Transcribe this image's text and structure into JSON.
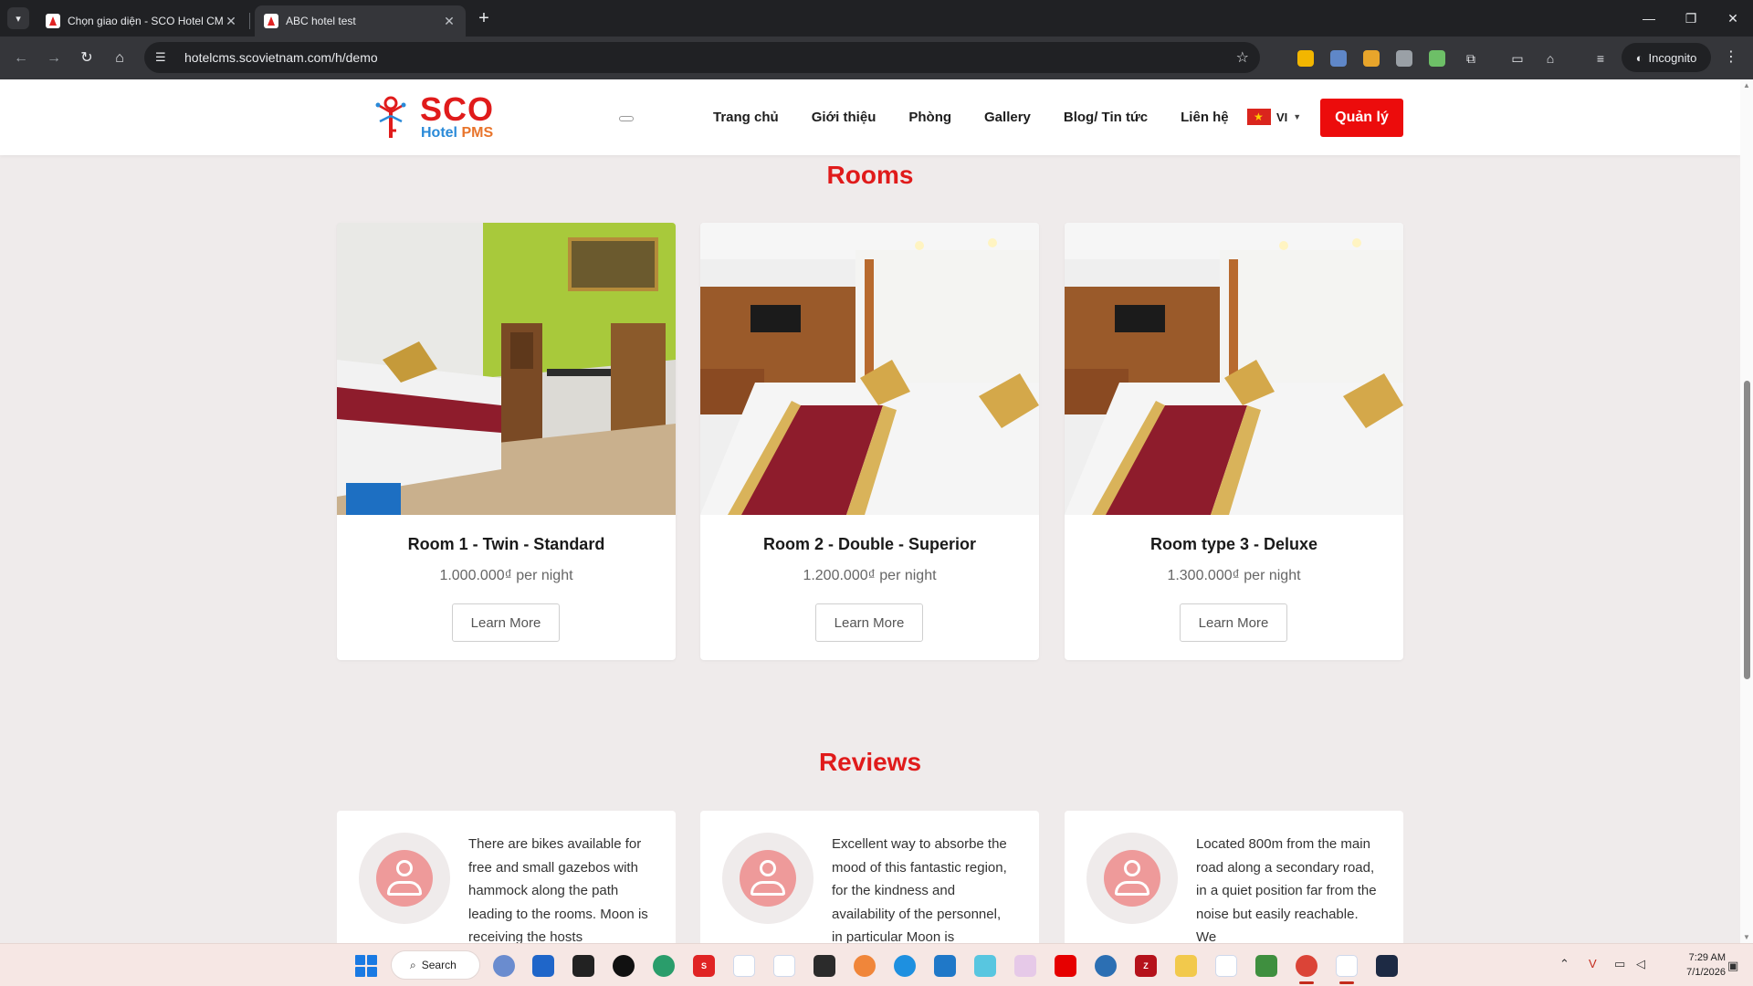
{
  "browser": {
    "tabs": [
      {
        "title": "Chọn giao diện - SCO Hotel CMS",
        "active": false
      },
      {
        "title": "ABC hotel test",
        "active": true
      }
    ],
    "url": "hotelcms.scovietnam.com/h/demo",
    "incognito_label": "Incognito"
  },
  "site": {
    "logo": {
      "brand": "SCO",
      "sub_hotel": "Hotel",
      "sub_pms": "PMS"
    },
    "nav": [
      "Trang chủ",
      "Giới thiệu",
      "Phòng",
      "Gallery",
      "Blog/ Tin tức",
      "Liên hệ"
    ],
    "language": "VI",
    "manage_label": "Quản lý"
  },
  "rooms": {
    "title": "Rooms",
    "items": [
      {
        "name": "Room 1 - Twin - Standard",
        "price": "1.000.000₫ per night",
        "button": "Learn More"
      },
      {
        "name": "Room 2 - Double - Superior",
        "price": "1.200.000₫ per night",
        "button": "Learn More"
      },
      {
        "name": "Room type 3 - Deluxe",
        "price": "1.300.000₫ per night",
        "button": "Learn More"
      }
    ]
  },
  "reviews": {
    "title": "Reviews",
    "items": [
      {
        "text": "There are bikes available for free and small gazebos with hammock along the path leading to the rooms. Moon is receiving the hosts"
      },
      {
        "text": "Excellent way to absorbe the mood of this fantastic region, for the kindness and availability of the personnel, in particular Moon is"
      },
      {
        "text": "Located 800m from the main road along a secondary road, in a quiet position far from the noise but easily reachable. We"
      }
    ]
  },
  "taskbar": {
    "search_label": "Search",
    "time": "7:29 AM",
    "date": "7/1/2026"
  },
  "colors": {
    "accent": "#e01b1b",
    "button": "#ec0c0c",
    "page_bg": "#efebeb",
    "avatar": "#ee9a9a"
  }
}
